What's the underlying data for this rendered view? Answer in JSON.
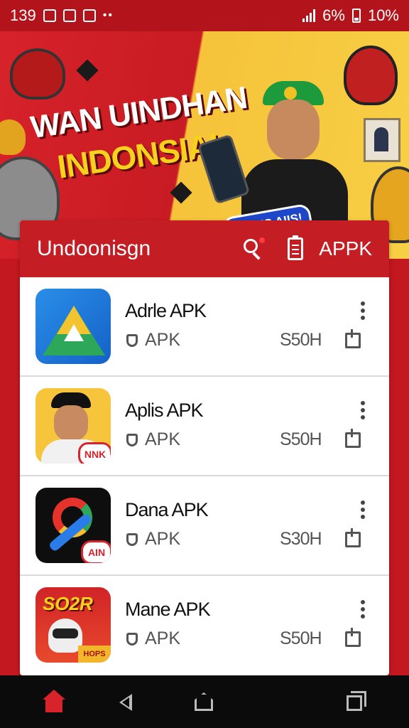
{
  "status_bar": {
    "time": "139",
    "dots": "••",
    "signal": "6%",
    "battery": "10%"
  },
  "banner": {
    "title_line1": "WAN UINDHAN",
    "title_line2": "INDONSIAI",
    "badge": "NIAITC AIIS!"
  },
  "header": {
    "title": "Undoonisgn",
    "apk_label": "APPK"
  },
  "apps": [
    {
      "name": "Adrle APK",
      "type": "APK",
      "size": "S50H"
    },
    {
      "name": "Aplis APK",
      "type": "APK",
      "size": "S50H",
      "icon_badge": "NNK"
    },
    {
      "name": "Dana APK",
      "type": "APK",
      "size": "S30H",
      "icon_badge": "AIN"
    },
    {
      "name": "Mane APK",
      "type": "APK",
      "size": "S50H",
      "icon_title": "SO2R",
      "icon_corner": "HOPS"
    }
  ],
  "colors": {
    "brand_red": "#c51d24",
    "banner_yellow": "#f6c33a",
    "navbar": "#0b0b0b"
  }
}
